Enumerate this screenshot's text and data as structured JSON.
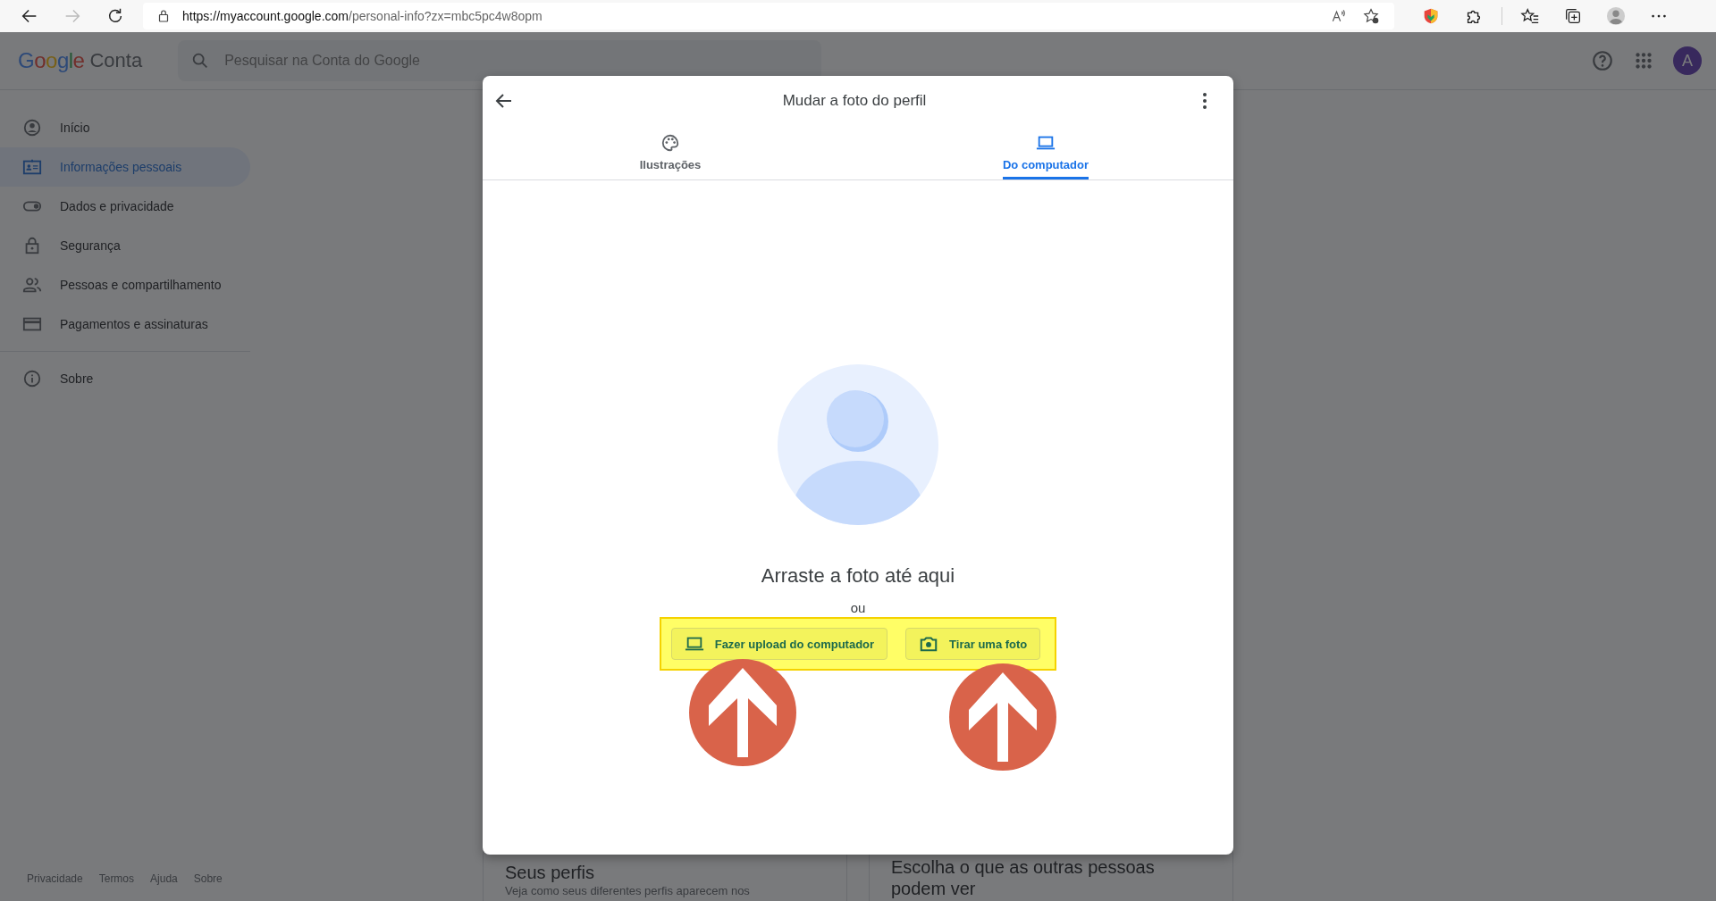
{
  "browser": {
    "url_host": "https://myaccount.google.com",
    "url_path": "/personal-info?zx=mbc5pc4w8opm"
  },
  "header": {
    "logo": "Google",
    "product": "Conta",
    "search_placeholder": "Pesquisar na Conta do Google",
    "avatar": "A"
  },
  "sidebar": {
    "items": [
      {
        "label": "Início",
        "kind": "account",
        "selected": false
      },
      {
        "label": "Informações pessoais",
        "kind": "id",
        "selected": true
      },
      {
        "label": "Dados e privacidade",
        "kind": "toggle",
        "selected": false
      },
      {
        "label": "Segurança",
        "kind": "lock",
        "selected": false
      },
      {
        "label": "Pessoas e compartilhamento",
        "kind": "people",
        "selected": false
      },
      {
        "label": "Pagamentos e assinaturas",
        "kind": "card",
        "selected": false
      }
    ],
    "footer_item": {
      "label": "Sobre",
      "kind": "info",
      "selected": false
    }
  },
  "footer_links": [
    "Privacidade",
    "Termos",
    "Ajuda",
    "Sobre"
  ],
  "cards": [
    {
      "title": "Seus perfis",
      "text": "Veja como seus diferentes perfis aparecem nos"
    },
    {
      "title": "Escolha o que as outras pessoas podem ver"
    }
  ],
  "dialog": {
    "title": "Mudar a foto do perfil",
    "tabs": [
      {
        "label": "Ilustrações",
        "kind": "palette",
        "selected": false
      },
      {
        "label": "Do computador",
        "kind": "laptop",
        "selected": true
      }
    ],
    "drop_text": "Arraste a foto até aqui",
    "or": "ou",
    "buttons": [
      {
        "label": "Fazer upload do computador",
        "kind": "laptop"
      },
      {
        "label": "Tirar uma foto",
        "kind": "camera"
      }
    ]
  }
}
